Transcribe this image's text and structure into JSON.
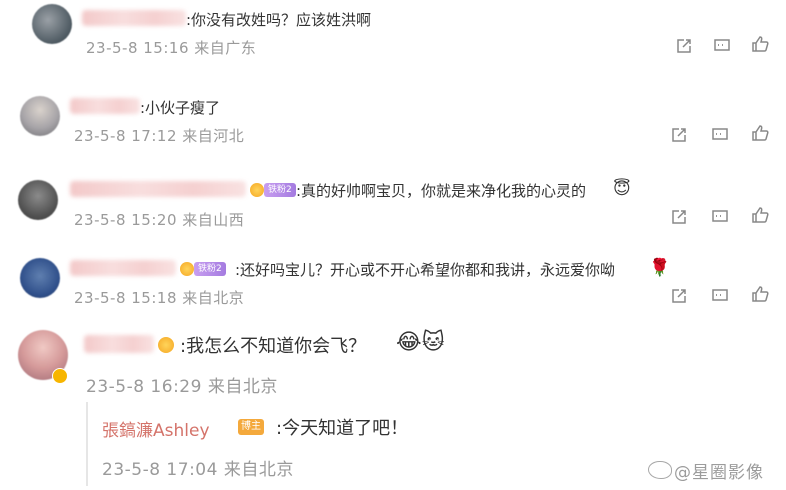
{
  "comments": [
    {
      "text": ":你没有改姓吗？应该姓洪啊",
      "meta": "23-5-8 15:16 来自广东"
    },
    {
      "text": ":小伙子瘦了",
      "meta": "23-5-8 17:12 来自河北"
    },
    {
      "text": ":真的好帅啊宝贝，你就是来净化我的心灵的",
      "emoji": "😇",
      "badge": "铁粉2",
      "meta": "23-5-8 15:20 来自山西"
    },
    {
      "text": ":还好吗宝儿？开心或不开心希望你都和我讲，永远爱你呦",
      "emoji": "🌹",
      "badge": "铁粉2",
      "meta": "23-5-8 15:18 来自北京"
    },
    {
      "text": ":我怎么不知道你会飞？",
      "emoji": "😂🐱",
      "meta": "23-5-8 16:29 来自北京"
    }
  ],
  "reply": {
    "author": "張鎬濂Ashley",
    "host_badge": "博主",
    "text": ":今天知道了吧！",
    "meta": "23-5-8 17:04 来自北京"
  },
  "watermark": "@星圈影像",
  "icons": {
    "share": "share-icon",
    "comment": "comment-icon",
    "like": "like-icon"
  },
  "colors": {
    "reply_author": "#d4736a",
    "host_badge": "#f4a93c",
    "meta_gray": "#9a9a9a"
  }
}
